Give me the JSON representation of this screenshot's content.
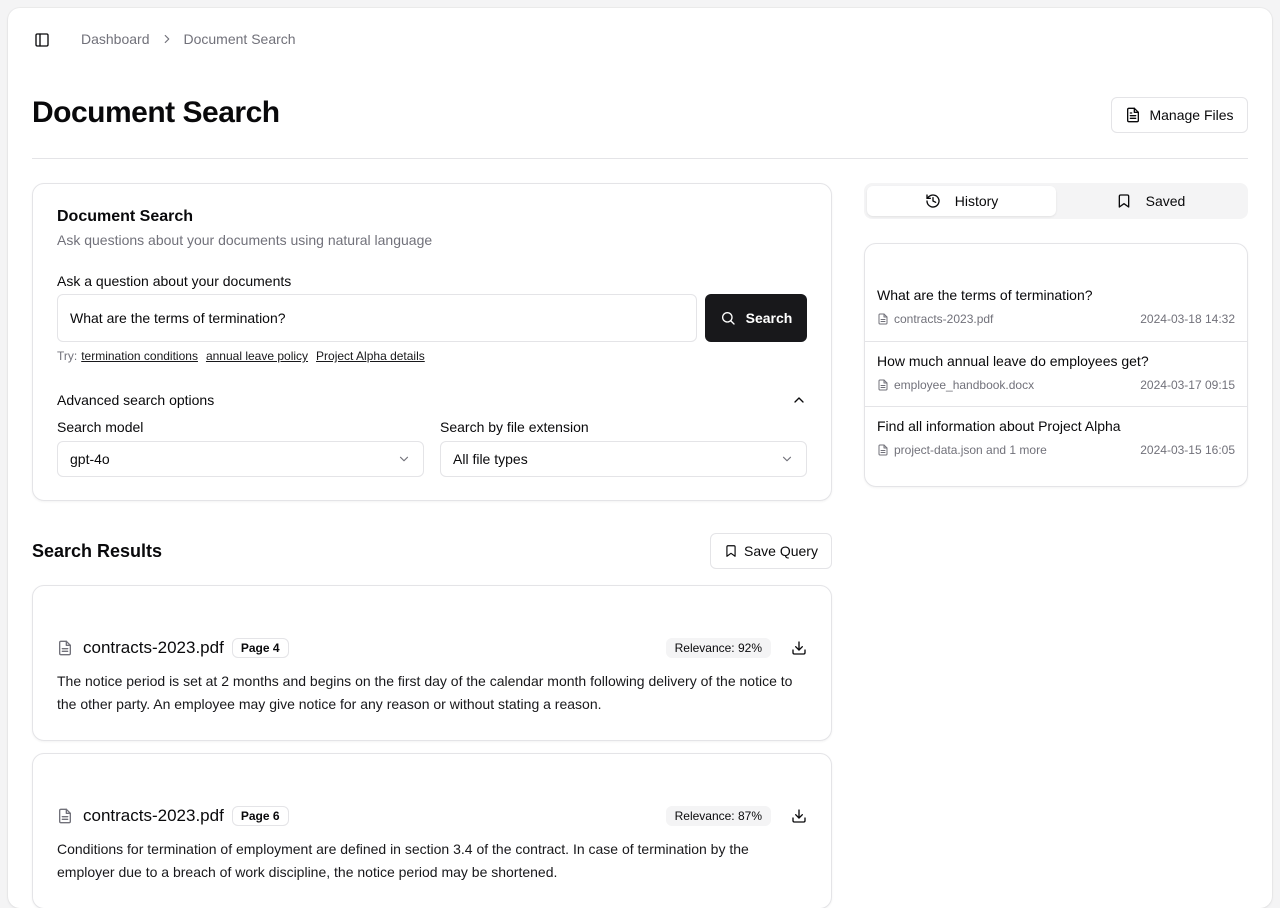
{
  "breadcrumb": {
    "root": "Dashboard",
    "current": "Document Search"
  },
  "page": {
    "title": "Document Search",
    "manage_files_label": "Manage Files"
  },
  "search_card": {
    "title": "Document Search",
    "description": "Ask questions about your documents using natural language",
    "question_label": "Ask a question about your documents",
    "question_value": "What are the terms of termination?",
    "search_button_label": "Search",
    "try_label": "Try:",
    "suggestions": [
      "termination conditions",
      "annual leave policy",
      "Project Alpha details"
    ],
    "advanced_label": "Advanced search options",
    "model_label": "Search model",
    "model_value": "gpt-4o",
    "extension_label": "Search by file extension",
    "extension_value": "All file types"
  },
  "results": {
    "title": "Search Results",
    "save_query_label": "Save Query",
    "items": [
      {
        "file": "contracts-2023.pdf",
        "page": "Page 4",
        "relevance": "Relevance: 92%",
        "text": "The notice period is set at 2 months and begins on the first day of the calendar month following delivery of the notice to the other party. An employee may give notice for any reason or without stating a reason."
      },
      {
        "file": "contracts-2023.pdf",
        "page": "Page 6",
        "relevance": "Relevance: 87%",
        "text": "Conditions for termination of employment are defined in section 3.4 of the contract. In case of termination by the employer due to a breach of work discipline, the notice period may be shortened."
      }
    ]
  },
  "sidebar_tabs": {
    "history": "History",
    "saved": "Saved",
    "active": "History"
  },
  "history": [
    {
      "question": "What are the terms of termination?",
      "file": "contracts-2023.pdf",
      "date": "2024-03-18 14:32"
    },
    {
      "question": "How much annual leave do employees get?",
      "file": "employee_handbook.docx",
      "date": "2024-03-17 09:15"
    },
    {
      "question": "Find all information about Project Alpha",
      "file": "project-data.json and 1 more",
      "date": "2024-03-15 16:05"
    }
  ],
  "icons": {
    "sidebar_toggle": "panel-left-icon",
    "breadcrumb_separator": "chevron-right-icon",
    "manage_files": "file-text-icon",
    "search": "search-icon",
    "advanced_toggle": "chevron-up-icon",
    "select_caret": "chevron-down-icon",
    "save_query": "bookmark-icon",
    "result_file": "file-text-icon",
    "download": "download-icon",
    "history_tab": "history-icon",
    "saved_tab": "bookmark-icon"
  },
  "colors": {
    "primary": "#18181b",
    "muted_text": "#71717a",
    "border": "#e4e4e7",
    "muted_bg": "#f4f4f5"
  }
}
